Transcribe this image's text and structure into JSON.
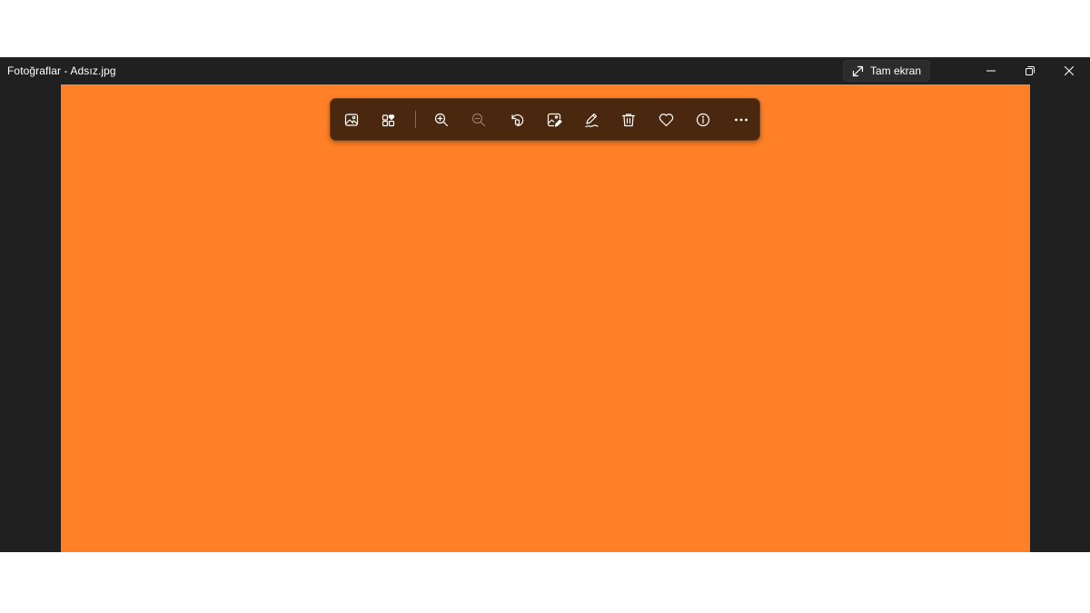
{
  "window": {
    "title": "Fotoğraflar - Adsız.jpg",
    "fullscreen_label": "Tam ekran"
  },
  "photo": {
    "fill_color": "#FF8027"
  },
  "toolbar": {
    "icons": [
      "image-icon",
      "add-to-collection-icon",
      "zoom-in-icon",
      "zoom-out-icon",
      "rotate-icon",
      "edit-image-icon",
      "draw-icon",
      "delete-icon",
      "favorite-icon",
      "info-icon",
      "more-icon"
    ]
  },
  "colors": {
    "window_bg": "#202020",
    "toolbar_bg": "#4A2810"
  }
}
